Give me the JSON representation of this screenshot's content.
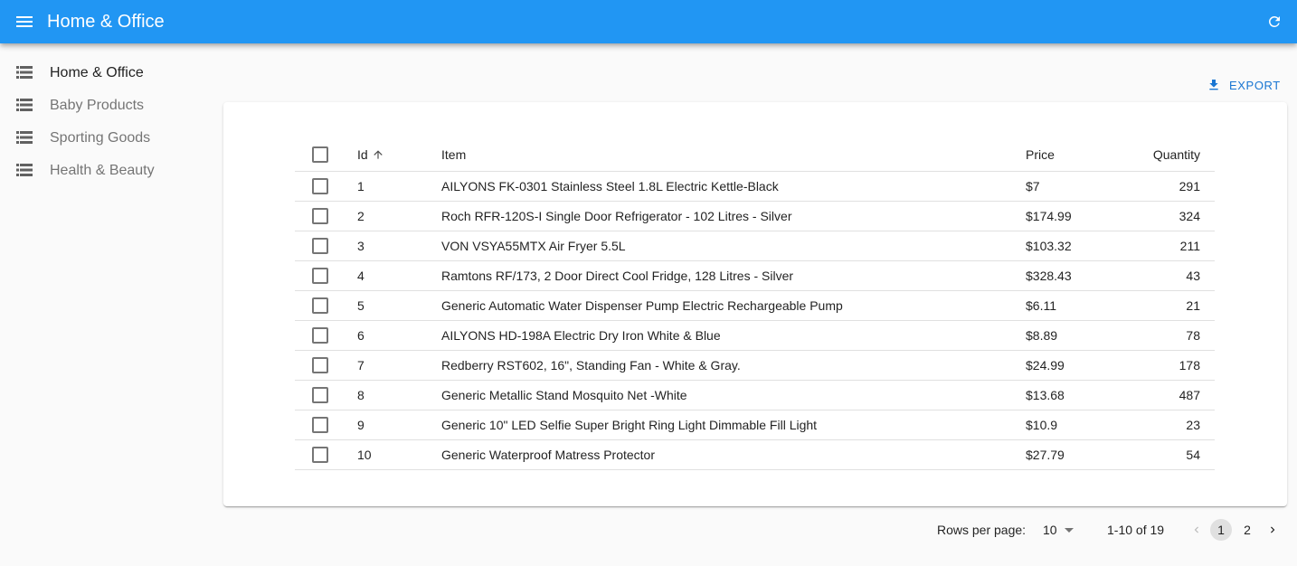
{
  "appbar": {
    "title": "Home & Office",
    "menu_icon": "menu-icon",
    "refresh_icon": "refresh-icon",
    "color": "#2196f3"
  },
  "sidebar": {
    "items": [
      {
        "label": "Home & Office",
        "icon": "list-icon",
        "active": true
      },
      {
        "label": "Baby Products",
        "icon": "list-icon",
        "active": false
      },
      {
        "label": "Sporting Goods",
        "icon": "list-icon",
        "active": false
      },
      {
        "label": "Health & Beauty",
        "icon": "list-icon",
        "active": false
      }
    ]
  },
  "toolbar": {
    "export_label": "EXPORT",
    "export_icon": "download-icon"
  },
  "table": {
    "columns": {
      "id": "Id",
      "item": "Item",
      "price": "Price",
      "quantity": "Quantity"
    },
    "sort": {
      "column": "id",
      "direction": "asc"
    },
    "rows": [
      {
        "id": "1",
        "item": "AILYONS FK-0301 Stainless Steel 1.8L Electric Kettle-Black",
        "price": "$7",
        "quantity": "291"
      },
      {
        "id": "2",
        "item": "Roch RFR-120S-I Single Door Refrigerator - 102 Litres - Silver",
        "price": "$174.99",
        "quantity": "324"
      },
      {
        "id": "3",
        "item": "VON VSYA55MTX Air Fryer 5.5L",
        "price": "$103.32",
        "quantity": "211"
      },
      {
        "id": "4",
        "item": "Ramtons RF/173, 2 Door Direct Cool Fridge, 128 Litres - Silver",
        "price": "$328.43",
        "quantity": "43"
      },
      {
        "id": "5",
        "item": "Generic Automatic Water Dispenser Pump Electric Rechargeable Pump",
        "price": "$6.11",
        "quantity": "21"
      },
      {
        "id": "6",
        "item": "AILYONS HD-198A Electric Dry Iron White & Blue",
        "price": "$8.89",
        "quantity": "78"
      },
      {
        "id": "7",
        "item": "Redberry RST602, 16\", Standing Fan - White & Gray.",
        "price": "$24.99",
        "quantity": "178"
      },
      {
        "id": "8",
        "item": "Generic Metallic Stand Mosquito Net -White",
        "price": "$13.68",
        "quantity": "487"
      },
      {
        "id": "9",
        "item": "Generic 10\" LED Selfie Super Bright Ring Light Dimmable Fill Light",
        "price": "$10.9",
        "quantity": "23"
      },
      {
        "id": "10",
        "item": "Generic Waterproof Matress Protector",
        "price": "$27.79",
        "quantity": "54"
      }
    ]
  },
  "pagination": {
    "rows_per_page_label": "Rows per page:",
    "rows_per_page_value": "10",
    "range_text": "1-10 of 19",
    "pages": [
      "1",
      "2"
    ],
    "current_page": "1"
  }
}
